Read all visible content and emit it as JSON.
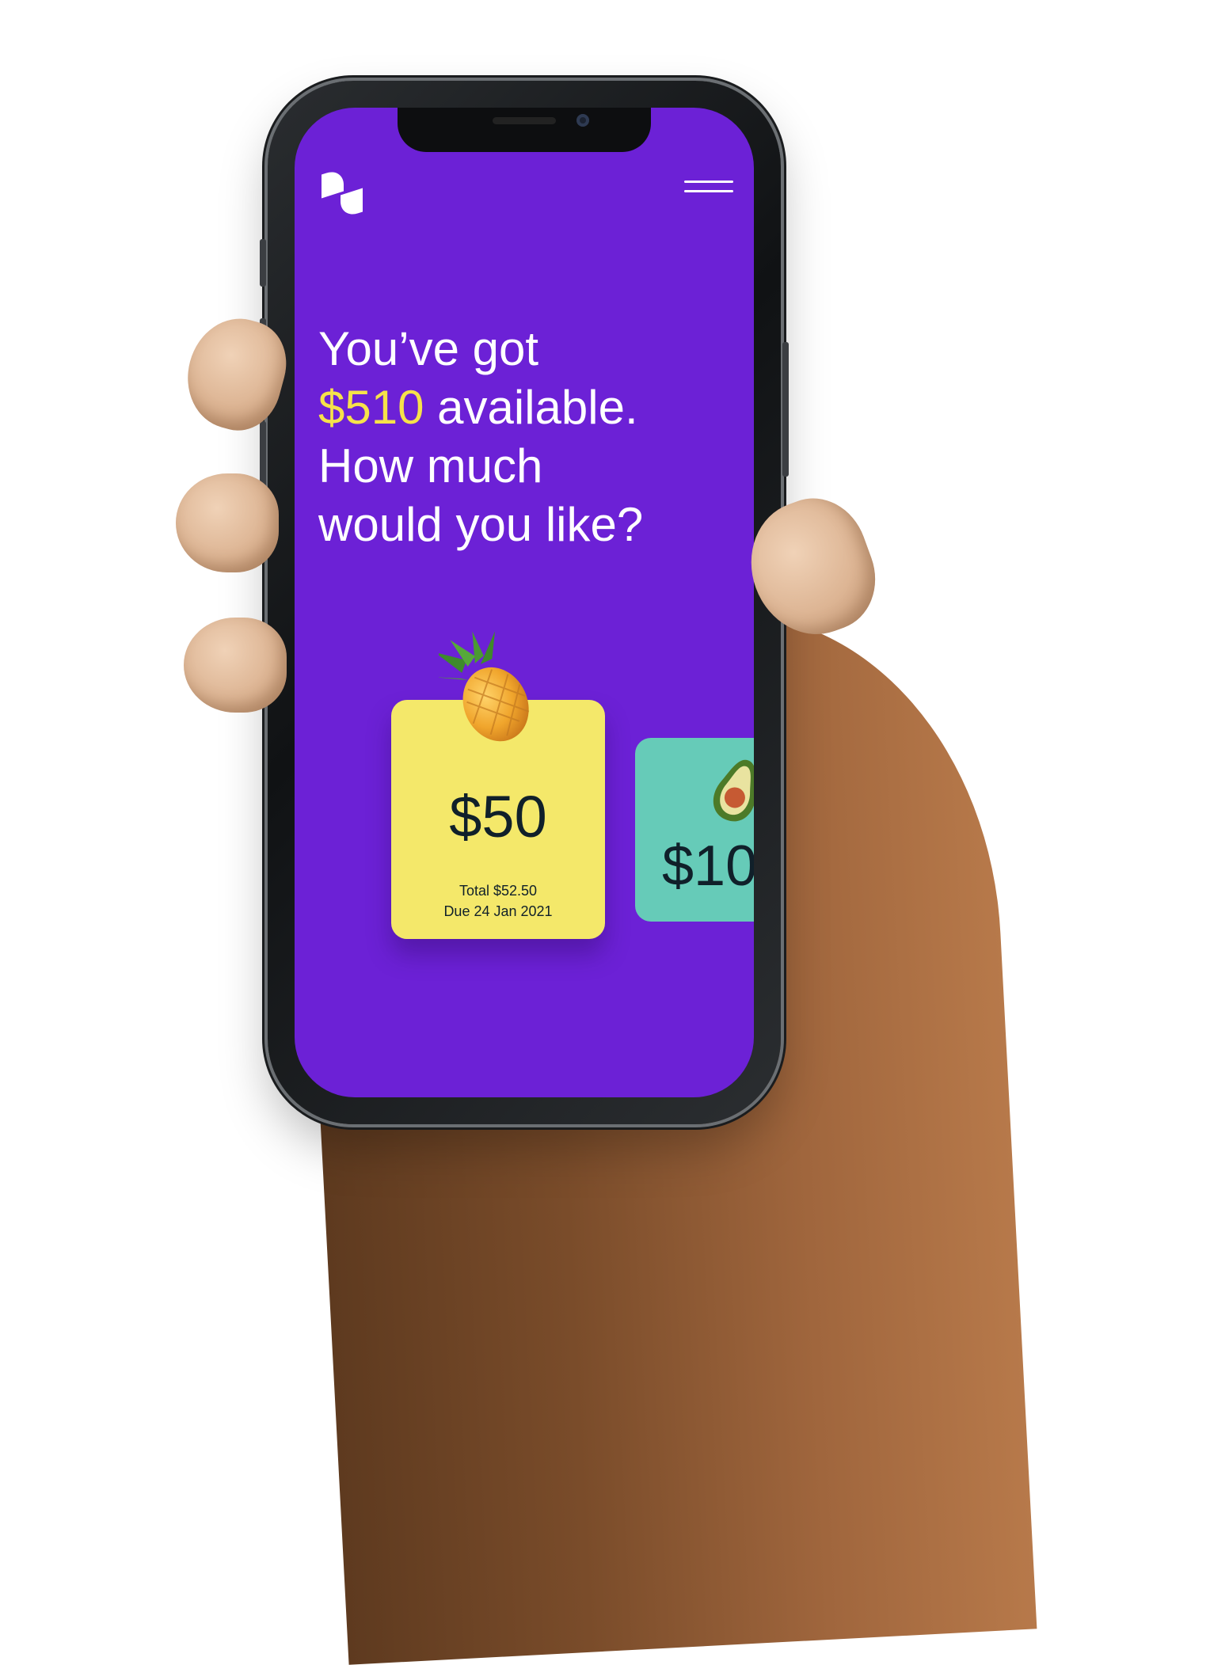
{
  "headline": {
    "line1": "You’ve got",
    "amount": "$510",
    "line2_rest": " available.",
    "line3": "How much",
    "line4": "would you like?"
  },
  "cards": [
    {
      "amount": "$50",
      "total": "Total $52.50",
      "due": "Due 24 Jan 2021",
      "color": "#f4e86a",
      "icon": "pineapple-icon"
    },
    {
      "amount": "$10",
      "color": "#66cbb8",
      "icon": "avocado-icon"
    }
  ],
  "colors": {
    "screen_bg": "#6c21d6",
    "accent": "#f6e24a",
    "text": "#ffffff"
  },
  "icons": {
    "logo": "brand-logo-icon",
    "menu": "hamburger-menu-icon"
  }
}
